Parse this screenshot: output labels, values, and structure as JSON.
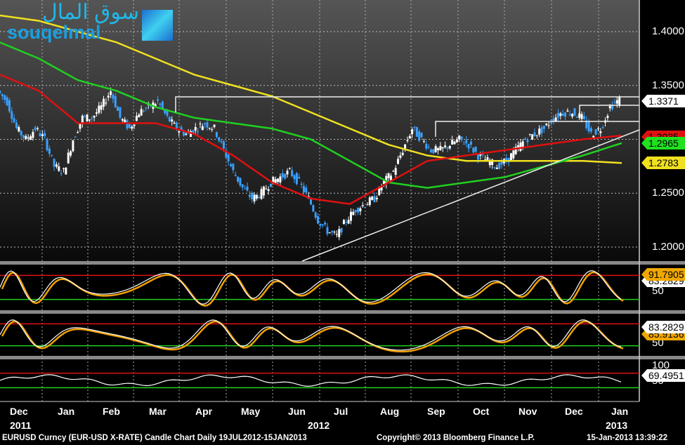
{
  "logo": {
    "arabic": "سوق المال",
    "latin": "souqelmal"
  },
  "footer": {
    "left": "EURUSD Curncy (EUR-USD X-RATE) Candle Chart  Daily 19JUL2012-15JAN2013",
    "center": "Copyright© 2013 Bloomberg Finance L.P.",
    "right": "15-Jan-2013 13:39:22"
  },
  "colors": {
    "yellow": "#f0e020",
    "green": "#20d020",
    "red": "#e01010",
    "candle_up": "#ffffff",
    "candle_down": "#3aa0ff"
  },
  "chart_data": {
    "type": "candlestick",
    "title": "EURUSD Curncy (EUR-USD X-RATE) Candle Chart",
    "ylim": [
      1.18,
      1.42
    ],
    "yticks": [
      "1.4000",
      "1.3500",
      "1.2500",
      "1.2000"
    ],
    "months": [
      "Dec",
      "Jan",
      "Feb",
      "Mar",
      "Apr",
      "May",
      "Jun",
      "Jul",
      "Aug",
      "Sep",
      "Oct",
      "Nov",
      "Dec",
      "Jan"
    ],
    "years": [
      "2011",
      "2012",
      "2013"
    ],
    "closes": [
      1.345,
      1.335,
      1.31,
      1.3,
      1.31,
      1.3,
      1.275,
      1.27,
      1.3,
      1.32,
      1.32,
      1.33,
      1.345,
      1.32,
      1.31,
      1.325,
      1.33,
      1.335,
      1.32,
      1.31,
      1.305,
      1.31,
      1.315,
      1.31,
      1.29,
      1.27,
      1.255,
      1.245,
      1.25,
      1.26,
      1.265,
      1.27,
      1.26,
      1.245,
      1.225,
      1.215,
      1.21,
      1.225,
      1.235,
      1.24,
      1.245,
      1.26,
      1.27,
      1.29,
      1.31,
      1.3,
      1.29,
      1.29,
      1.295,
      1.3,
      1.295,
      1.285,
      1.28,
      1.275,
      1.28,
      1.29,
      1.3,
      1.305,
      1.31,
      1.32,
      1.325,
      1.325,
      1.32,
      1.305,
      1.31,
      1.33,
      1.337
    ],
    "ma_yellow": [
      1.415,
      1.41,
      1.4,
      1.39,
      1.375,
      1.36,
      1.35,
      1.34,
      1.325,
      1.31,
      1.295,
      1.285,
      1.28,
      1.28,
      1.28,
      1.28,
      1.278
    ],
    "ma_green": [
      1.39,
      1.375,
      1.355,
      1.345,
      1.33,
      1.32,
      1.315,
      1.31,
      1.3,
      1.28,
      1.26,
      1.255,
      1.26,
      1.265,
      1.275,
      1.285,
      1.2965
    ],
    "ma_red": [
      1.36,
      1.345,
      1.315,
      1.315,
      1.315,
      1.305,
      1.285,
      1.26,
      1.245,
      1.24,
      1.26,
      1.28,
      1.285,
      1.29,
      1.295,
      1.3,
      1.3035
    ],
    "last_values": {
      "close": "1.3371",
      "red_ma": "1.3035",
      "green_ma": "1.2965",
      "yellow_ma": "1.2783"
    },
    "oscillators": [
      {
        "name": "stochastic-1",
        "last": "91.7905",
        "second": "83.2829",
        "tick": "50",
        "upper": 80,
        "lower": 20
      },
      {
        "name": "stochastic-2",
        "last": "83.2829",
        "second": "85.9136",
        "tick": "50",
        "upper": 80,
        "lower": 20
      },
      {
        "name": "rsi",
        "last": "69.4951",
        "tick_hi": "100",
        "tick": "50",
        "upper": 70,
        "lower": 30
      }
    ]
  }
}
